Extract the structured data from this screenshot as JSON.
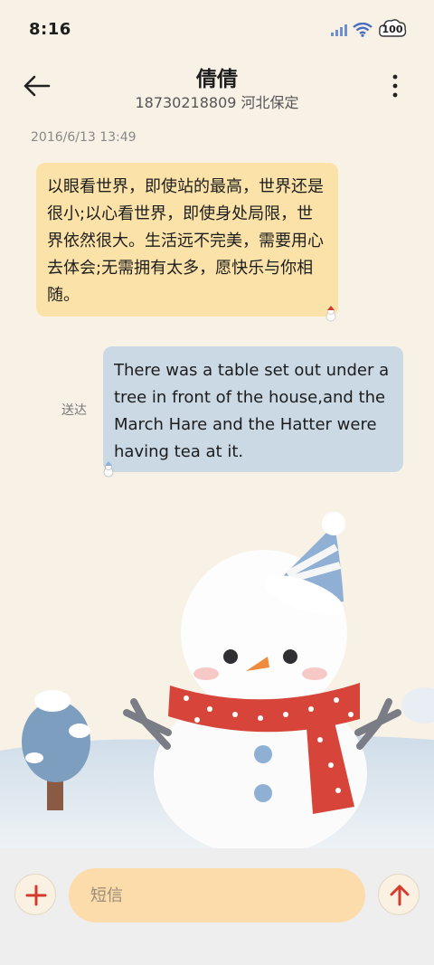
{
  "status_bar": {
    "time": "8:16",
    "battery": "100",
    "icons": [
      "signal-icon",
      "wifi-icon",
      "battery-icon"
    ]
  },
  "header": {
    "title": "倩倩",
    "subtitle": "18730218809 河北保定"
  },
  "conversation": {
    "timestamp": "2016/6/13 13:49",
    "messages": [
      {
        "direction": "incoming",
        "text": "以眼看世界，即使站的最高，世界还是很小;以心看世界，即使身处局限，世界依然很大。生活远不完美，需要用心去体会;无需拥有太多，愿快乐与你相随。"
      },
      {
        "direction": "outgoing",
        "text": "There was a table set out under a tree in front of the house,and the March Hare and the Hatter were having tea at it.",
        "status": "送达"
      }
    ]
  },
  "composer": {
    "placeholder": "短信"
  },
  "colors": {
    "background": "#f8f1e6",
    "incoming_bubble": "#fbe2a8",
    "outgoing_bubble": "#cbd9e4",
    "accent": "#d43b2e",
    "input": "#fbdcaa"
  }
}
